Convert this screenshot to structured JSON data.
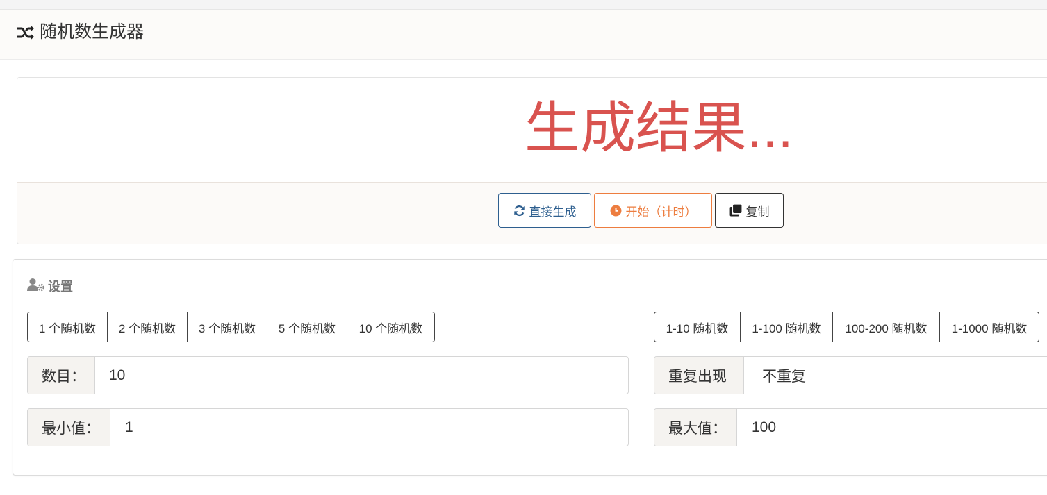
{
  "header": {
    "title": "随机数生成器",
    "icon": "shuffle-icon"
  },
  "result": {
    "text": "生成结果...",
    "color": "#d9534f"
  },
  "actions": {
    "generate_label": "直接生成",
    "start_label": "开始（计时）",
    "copy_label": "复制"
  },
  "settings": {
    "title": "设置",
    "count_presets": [
      "1 个随机数",
      "2 个随机数",
      "3 个随机数",
      "5 个随机数",
      "10 个随机数"
    ],
    "range_presets": [
      "1-10 随机数",
      "1-100 随机数",
      "100-200 随机数",
      "1-1000 随机数"
    ],
    "count_label": "数目：",
    "count_value": "10",
    "repeat_label": "重复出现",
    "repeat_value": "不重复",
    "min_label": "最小值：",
    "min_value": "1",
    "max_label": "最大值：",
    "max_value": "100"
  },
  "colors": {
    "primary": "#2e5f8f",
    "warning": "#ed7d3f",
    "danger": "#d9534f"
  }
}
